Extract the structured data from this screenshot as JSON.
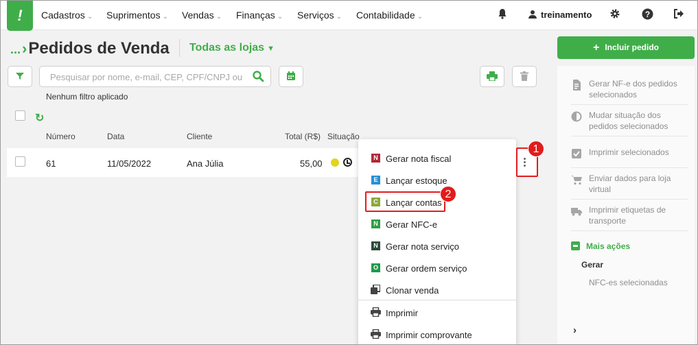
{
  "logo": {
    "glyph": "!"
  },
  "nav": {
    "items": [
      {
        "label": "Cadastros"
      },
      {
        "label": "Suprimentos"
      },
      {
        "label": "Vendas"
      },
      {
        "label": "Finanças"
      },
      {
        "label": "Serviços"
      },
      {
        "label": "Contabilidade"
      }
    ],
    "user": "treinamento"
  },
  "page": {
    "breadcrumb_dots": "...",
    "title": "Pedidos de Venda",
    "store_selector": "Todas as lojas"
  },
  "search": {
    "placeholder": "Pesquisar por nome, e-mail, CEP, CPF/CNPJ ou"
  },
  "filter_note": "Nenhum filtro aplicado",
  "table": {
    "headers": {
      "numero": "Número",
      "data": "Data",
      "cliente": "Cliente",
      "total": "Total (R$)",
      "situacao": "Situação"
    },
    "rows": [
      {
        "numero": "61",
        "data": "11/05/2022",
        "cliente": "Ana Júlia",
        "total": "55,00",
        "status_color": "#e3d41e"
      }
    ]
  },
  "menu": {
    "items": [
      {
        "badge": "N",
        "badge_color": "#b3283b",
        "label": "Gerar nota fiscal"
      },
      {
        "badge": "E",
        "badge_color": "#2a8fd4",
        "label": "Lançar estoque"
      },
      {
        "badge": "C",
        "badge_color": "#8ea63a",
        "label": "Lançar contas"
      },
      {
        "badge": "N",
        "badge_color": "#2f9e44",
        "label": "Gerar NFC-e"
      },
      {
        "badge": "N",
        "badge_color": "#2e4a3a",
        "label": "Gerar nota serviço"
      },
      {
        "badge": "O",
        "badge_color": "#1e9a4c",
        "label": "Gerar ordem serviço"
      },
      {
        "icon": "copy-icon",
        "label": "Clonar venda"
      },
      {
        "icon": "printer-icon",
        "label": "Imprimir"
      },
      {
        "icon": "printer-icon",
        "label": "Imprimir comprovante"
      }
    ]
  },
  "steps": {
    "one": "1",
    "two": "2"
  },
  "panel": {
    "add_button": "Incluir pedido",
    "actions": [
      {
        "icon": "file-invoice-icon",
        "label": "Gerar NF-e dos pedidos selecionados"
      },
      {
        "icon": "half-circle-icon",
        "label": "Mudar situação dos pedidos selecionados"
      },
      {
        "icon": "checkbox-icon",
        "label": "Imprimir selecionados"
      },
      {
        "icon": "cart-icon",
        "label": "Enviar dados para loja virtual"
      },
      {
        "icon": "truck-icon",
        "label": "Imprimir etiquetas de transporte"
      }
    ],
    "more_actions": "Mais ações",
    "group_label": "Gerar",
    "group_item": "NFC-es selecionadas"
  },
  "colors": {
    "brand": "#3fae49",
    "highlight": "#e21c1c"
  }
}
